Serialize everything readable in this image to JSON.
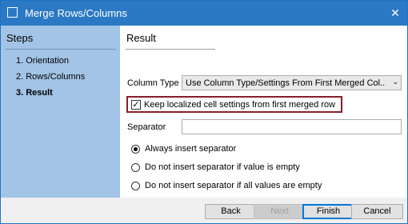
{
  "window": {
    "title": "Merge Rows/Columns",
    "close_glyph": "✕"
  },
  "sidebar": {
    "title": "Steps",
    "steps": [
      {
        "label": "1. Orientation"
      },
      {
        "label": "2. Rows/Columns"
      },
      {
        "label": "3. Result"
      }
    ]
  },
  "main": {
    "title": "Result",
    "column_type": {
      "label": "Column Type",
      "value": "Use Column Type/Settings From First Merged Col..."
    },
    "keep_settings": {
      "label": "Keep localized cell settings from first merged row",
      "checked": true
    },
    "separator": {
      "label": "Separator",
      "value": ""
    },
    "radios": [
      {
        "label": "Always insert separator",
        "selected": true
      },
      {
        "label": "Do not insert separator if value is empty",
        "selected": false
      },
      {
        "label": "Do not insert separator if all values are empty",
        "selected": false
      }
    ]
  },
  "footer": {
    "back": "Back",
    "next": "Next",
    "finish": "Finish",
    "cancel": "Cancel"
  },
  "colors": {
    "titlebar": "#2b79c4",
    "sidebar": "#a3c4e6",
    "highlight_border": "#8b1d2a"
  }
}
